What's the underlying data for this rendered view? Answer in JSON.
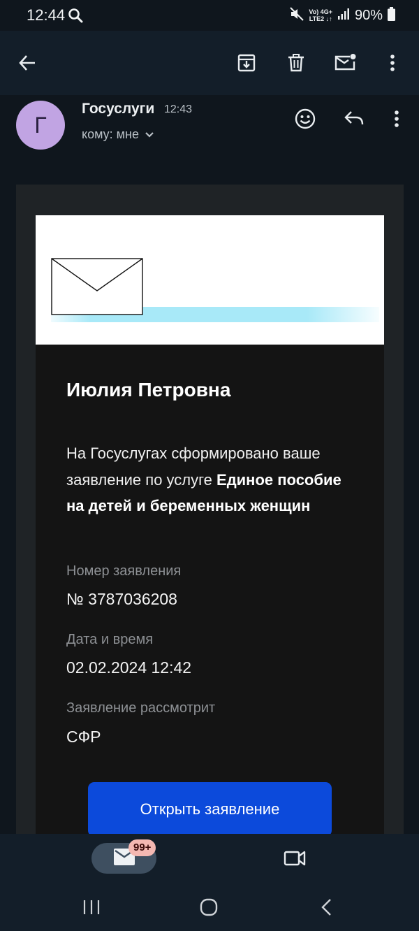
{
  "status": {
    "time": "12:44",
    "network_top": "Vo) 4G+",
    "network_bottom": "LTE2 ↓↑",
    "battery": "90%",
    "icons": [
      "search-icon",
      "mute-icon",
      "signal-icon",
      "battery-icon"
    ]
  },
  "toolbar": {
    "icons": [
      "back-arrow-icon",
      "archive-icon",
      "delete-icon",
      "mark-unread-icon",
      "more-vert-icon"
    ]
  },
  "sender": {
    "avatar_letter": "Г",
    "name": "Госуслуги",
    "time": "12:43",
    "recipient": "кому: мне",
    "icons": [
      "emoji-icon",
      "reply-icon",
      "more-vert-icon"
    ]
  },
  "email": {
    "greeting": "Июлия Петровна",
    "message_intro": "На Госуслугах сформировано ваше заявление по услуге ",
    "message_service": "Единое пособие на детей и беременных женщин",
    "fields": [
      {
        "label": "Номер заявления",
        "value": "№ 3787036208"
      },
      {
        "label": "Дата и время",
        "value": "02.02.2024 12:42"
      },
      {
        "label": "Заявление рассмотрит",
        "value": "СФР"
      }
    ],
    "button_label": "Открыть заявление"
  },
  "bottom_nav": {
    "mail_badge": "99+",
    "icons": [
      "mail-icon",
      "meet-video-icon"
    ],
    "system_icons": [
      "recent-apps-icon",
      "home-icon",
      "back-icon"
    ]
  },
  "colors": {
    "accent_button": "#0c4adb",
    "avatar": "#c1a4e3",
    "badge": "#f4b8b2"
  }
}
